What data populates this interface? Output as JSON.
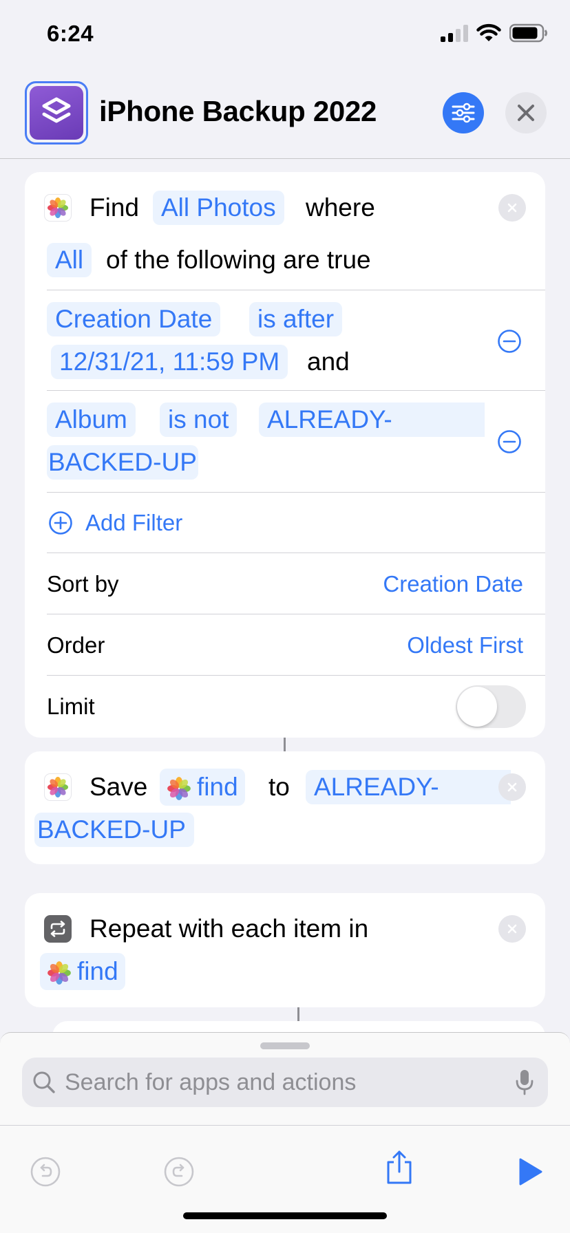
{
  "status_bar": {
    "time": "6:24"
  },
  "header": {
    "title": "iPhone Backup 2022",
    "icon": "shortcuts-icon"
  },
  "find_action": {
    "verb": "Find",
    "target": "All Photos",
    "where": "where",
    "quantifier": "All",
    "following": "of the following are true",
    "filters": [
      {
        "field": "Creation Date",
        "operator": "is after",
        "value": "12/31/21, 11:59 PM",
        "join": "and"
      },
      {
        "field": "Album",
        "operator": "is not",
        "value_line1": "ALREADY-",
        "value_line2": "BACKED-UP"
      }
    ],
    "add_filter": "Add Filter",
    "sort_by": {
      "label": "Sort by",
      "value": "Creation Date"
    },
    "order": {
      "label": "Order",
      "value": "Oldest First"
    },
    "limit": {
      "label": "Limit",
      "enabled": false
    }
  },
  "save_action": {
    "verb": "Save",
    "variable": "find",
    "to": "to",
    "album_line1": "ALREADY-",
    "album_line2": "BACKED-UP"
  },
  "repeat_action": {
    "text": "Repeat with each item in",
    "variable": "find"
  },
  "bottom_sheet": {
    "search_placeholder": "Search for apps and actions"
  },
  "colors": {
    "accent": "#3478f6",
    "token_bg": "#ebf3fe",
    "shortcut_icon": "#7b4cc9"
  }
}
